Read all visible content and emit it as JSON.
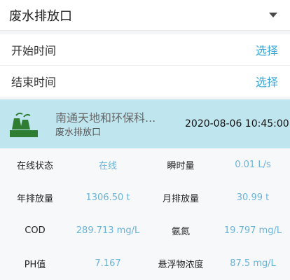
{
  "dropdown": {
    "label": "废水排放口"
  },
  "start_time": {
    "label": "开始时间",
    "action": "选择"
  },
  "end_time": {
    "label": "结束时间",
    "action": "选择"
  },
  "station": {
    "name": "南通天地和环保科...",
    "outlet": "废水排放口",
    "timestamp": "2020-08-06 10:45:00"
  },
  "metrics": [
    {
      "label1": "在线状态",
      "value1": "在线",
      "label2": "瞬时量",
      "value2": "0.01 L/s"
    },
    {
      "label1": "年排放量",
      "value1": "1306.50 t",
      "label2": "月排放量",
      "value2": "30.99 t"
    },
    {
      "label1": "COD",
      "value1": "289.713 mg/L",
      "label2": "氨氮",
      "value2": "19.797 mg/L"
    },
    {
      "label1": "PH值",
      "value1": "7.167",
      "label2": "悬浮物浓度",
      "value2": "87.5 mg/L"
    }
  ],
  "colors": {
    "accent": "#3aa8d8",
    "station_bg": "#bfe5ef",
    "icon": "#2e7d32"
  }
}
